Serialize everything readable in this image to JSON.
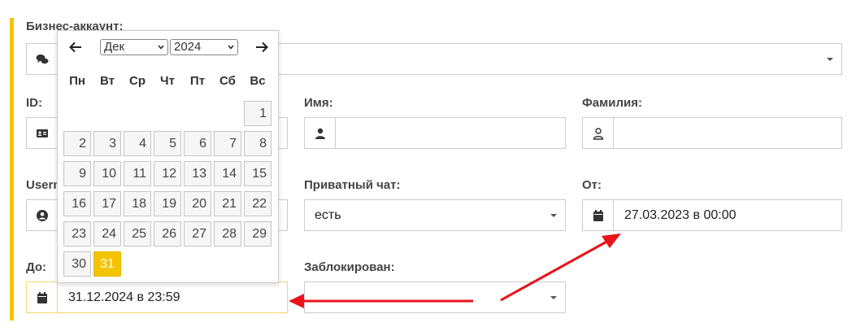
{
  "form": {
    "business_account_label": "Бизнес-аккаунт:",
    "id_label": "ID:",
    "first_name_label": "Имя:",
    "last_name_label": "Фамилия:",
    "username_label": "Usern",
    "private_chat_label": "Приватный чат:",
    "private_chat_value": "есть",
    "from_label": "От:",
    "from_value": "27.03.2023 в 00:00",
    "to_label": "До:",
    "to_value": "31.12.2024 в 23:59",
    "blocked_label": "Заблокирован:"
  },
  "datepicker": {
    "month": "Дек",
    "year": "2024",
    "weekdays": [
      "Пн",
      "Вт",
      "Ср",
      "Чт",
      "Пт",
      "Сб",
      "Вс"
    ],
    "days": [
      "1",
      "2",
      "3",
      "4",
      "5",
      "6",
      "7",
      "8",
      "9",
      "10",
      "11",
      "12",
      "13",
      "14",
      "15",
      "16",
      "17",
      "18",
      "19",
      "20",
      "21",
      "22",
      "23",
      "24",
      "25",
      "26",
      "27",
      "28",
      "29",
      "30",
      "31"
    ],
    "selected_day": "31"
  },
  "colors": {
    "accent": "#f5c400",
    "annotation_arrow": "#e8151b"
  }
}
